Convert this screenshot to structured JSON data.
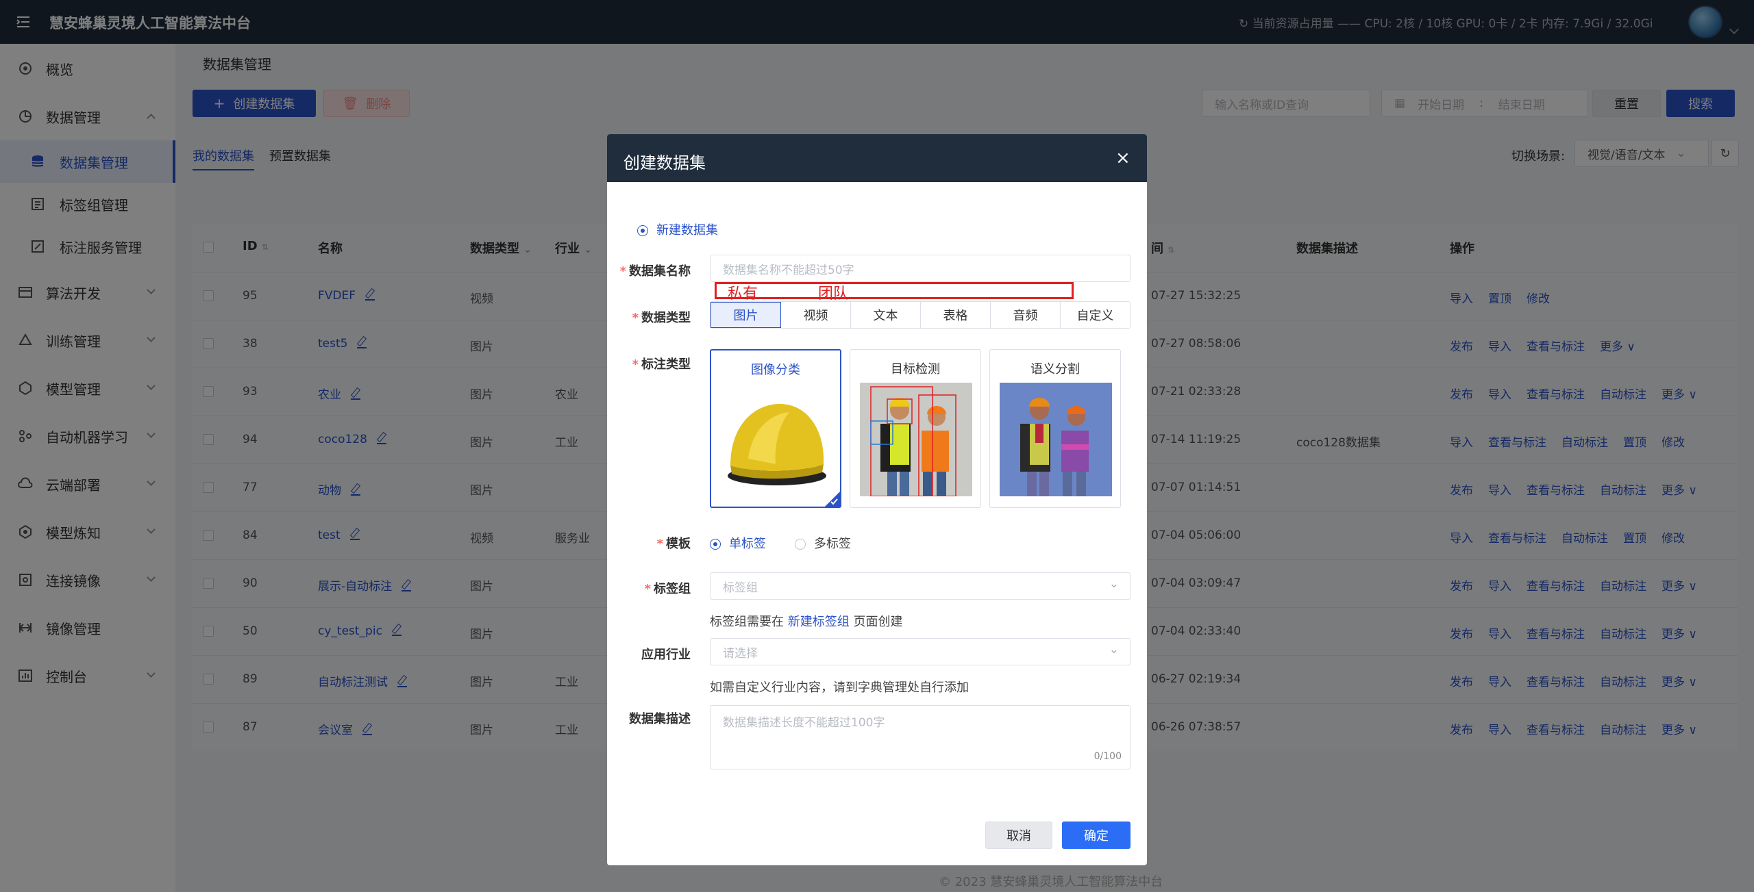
{
  "app": {
    "title": "慧安蜂巢灵境人工智能算法中台",
    "resource_text": "当前资源占用量 —— CPU: 2核 / 10核 GPU: 0卡 / 2卡 内存: 7.9Gi / 32.0Gi"
  },
  "sidebar": {
    "items": [
      {
        "label": "概览",
        "icon": "overview-icon"
      },
      {
        "label": "数据管理",
        "icon": "data-icon"
      },
      {
        "label": "数据集管理",
        "icon": "database-icon"
      },
      {
        "label": "标签组管理",
        "icon": "label-icon"
      },
      {
        "label": "标注服务管理",
        "icon": "annotate-icon"
      },
      {
        "label": "算法开发",
        "icon": "algorithm-icon"
      },
      {
        "label": "训练管理",
        "icon": "training-icon"
      },
      {
        "label": "模型管理",
        "icon": "model-icon"
      },
      {
        "label": "自动机器学习",
        "icon": "automl-icon"
      },
      {
        "label": "云端部署",
        "icon": "cloud-icon"
      },
      {
        "label": "模型炼知",
        "icon": "distill-icon"
      },
      {
        "label": "连接镜像",
        "icon": "link-icon"
      },
      {
        "label": "镜像管理",
        "icon": "image-icon"
      },
      {
        "label": "控制台",
        "icon": "console-icon"
      }
    ]
  },
  "page": {
    "breadcrumb": "数据集管理",
    "create_button": "创建数据集",
    "delete_button": "删除",
    "search_placeholder": "输入名称或ID查询",
    "start_date": "开始日期",
    "end_date": "结束日期",
    "date_sep": ":",
    "reset_button": "重置",
    "search_button": "搜索",
    "tabs": [
      "我的数据集",
      "预置数据集"
    ],
    "scene_label": "切换场景:",
    "scene_value": "视觉/语音/文本"
  },
  "table": {
    "headers": {
      "id": "ID",
      "name": "名称",
      "type": "数据类型",
      "industry": "行业",
      "time": "间",
      "desc": "数据集描述",
      "ops": "操作"
    },
    "rows": [
      {
        "id": "95",
        "name": "FVDEF",
        "type": "视频",
        "industry": "",
        "time": "07-27 15:32:25",
        "desc": "",
        "ops": [
          "导入",
          "置顶",
          "修改"
        ]
      },
      {
        "id": "38",
        "name": "test5",
        "type": "图片",
        "industry": "",
        "time": "07-27 08:58:06",
        "desc": "",
        "ops": [
          "发布",
          "导入",
          "查看与标注",
          "更多 ∨"
        ]
      },
      {
        "id": "93",
        "name": "农业",
        "type": "图片",
        "industry": "农业",
        "time": "07-21 02:33:28",
        "desc": "",
        "ops": [
          "发布",
          "导入",
          "查看与标注",
          "自动标注",
          "更多 ∨"
        ]
      },
      {
        "id": "94",
        "name": "coco128",
        "type": "图片",
        "industry": "工业",
        "time": "07-14 11:19:25",
        "desc": "coco128数据集",
        "ops": [
          "导入",
          "查看与标注",
          "自动标注",
          "置顶",
          "修改"
        ]
      },
      {
        "id": "77",
        "name": "动物",
        "type": "图片",
        "industry": "",
        "time": "07-07 01:14:51",
        "desc": "",
        "ops": [
          "发布",
          "导入",
          "查看与标注",
          "自动标注",
          "更多 ∨"
        ]
      },
      {
        "id": "84",
        "name": "test",
        "type": "视频",
        "industry": "服务业",
        "time": "07-04 05:06:00",
        "desc": "",
        "ops": [
          "导入",
          "查看与标注",
          "自动标注",
          "置顶",
          "修改"
        ]
      },
      {
        "id": "90",
        "name": "展示-自动标注",
        "type": "图片",
        "industry": "",
        "time": "07-04 03:09:47",
        "desc": "",
        "ops": [
          "发布",
          "导入",
          "查看与标注",
          "自动标注",
          "更多 ∨"
        ]
      },
      {
        "id": "50",
        "name": "cy_test_pic",
        "type": "图片",
        "industry": "",
        "time": "07-04 02:33:40",
        "desc": "",
        "ops": [
          "发布",
          "导入",
          "查看与标注",
          "自动标注",
          "更多 ∨"
        ]
      },
      {
        "id": "89",
        "name": "自动标注测试",
        "type": "图片",
        "industry": "工业",
        "time": "06-27 02:19:34",
        "desc": "",
        "ops": [
          "发布",
          "导入",
          "查看与标注",
          "自动标注",
          "更多 ∨"
        ]
      },
      {
        "id": "87",
        "name": "会议室",
        "type": "图片",
        "industry": "工业",
        "time": "06-26 07:38:57",
        "desc": "",
        "ops": [
          "发布",
          "导入",
          "查看与标注",
          "自动标注",
          "更多 ∨"
        ]
      }
    ]
  },
  "dialog": {
    "title": "创建数据集",
    "close": "×",
    "mode_label": "新建数据集",
    "name_label": "数据集名称",
    "name_placeholder": "数据集名称不能超过50字",
    "annotation_private": "私有",
    "annotation_team": "团队",
    "type_label": "数据类型",
    "types": [
      "图片",
      "视频",
      "文本",
      "表格",
      "音频",
      "自定义"
    ],
    "mark_label": "标注类型",
    "mark_types": [
      "图像分类",
      "目标检测",
      "语义分割"
    ],
    "template_label": "模板",
    "template_single": "单标签",
    "template_multi": "多标签",
    "group_label": "标签组",
    "group_placeholder": "标签组",
    "group_hint_pre": "标签组需要在",
    "group_hint_link": "新建标签组",
    "group_hint_post": "页面创建",
    "industry_label": "应用行业",
    "industry_placeholder": "请选择",
    "industry_hint": "如需自定义行业内容，请到字典管理处自行添加",
    "desc_label": "数据集描述",
    "desc_placeholder": "数据集描述长度不能超过100字",
    "desc_counter": "0/100",
    "cancel": "取消",
    "confirm": "确定"
  },
  "footer": "© 2023 慧安蜂巢灵境人工智能算法中台",
  "colors": {
    "primary": "#2b53c8",
    "header": "#1f2d3d",
    "danger": "#f56c6c"
  }
}
